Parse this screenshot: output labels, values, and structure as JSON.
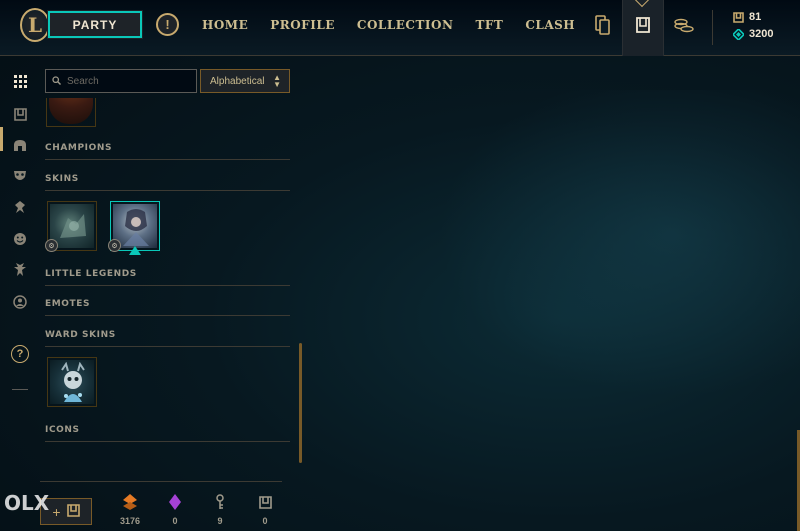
{
  "top_bar": {
    "party_label": "PARTY",
    "alert_symbol": "!",
    "logo_letter": "L",
    "nav": [
      "HOME",
      "PROFILE",
      "COLLECTION",
      "TFT",
      "CLASH"
    ],
    "icons": [
      "collection-cards-icon",
      "loot-chest-icon",
      "store-coins-icon"
    ],
    "currencies": {
      "blue_essence": "81",
      "riot_points": "3200"
    }
  },
  "left_rail": {
    "icons": [
      "grid-icon",
      "chest-icon",
      "helmet-icon",
      "mask-icon",
      "ward-icon",
      "emote-icon",
      "little-legend-icon",
      "profile-icon"
    ],
    "help_symbol": "?"
  },
  "search": {
    "placeholder": "Search"
  },
  "sort": {
    "selected": "Alphabetical"
  },
  "sections": {
    "champions": "CHAMPIONS",
    "skins": "SKINS",
    "little_legends": "LITTLE LEGENDS",
    "emotes": "EMOTES",
    "ward_skins": "WARD SKINS",
    "icons": "ICONS"
  },
  "loot_bar": {
    "items": [
      {
        "icon": "orange-essence-icon",
        "count": "3176",
        "color": "#e57a25"
      },
      {
        "icon": "mythic-essence-icon",
        "count": "0",
        "color": "#a542d6"
      },
      {
        "icon": "key-icon",
        "count": "9",
        "color": "#a09b8c"
      },
      {
        "icon": "chest-icon",
        "count": "0",
        "color": "#a09b8c"
      }
    ],
    "craft_plus": "+"
  },
  "watermark": "OLX",
  "colors": {
    "gold": "#c8aa6e",
    "teal": "#0ac8b9",
    "background": "#071820"
  }
}
